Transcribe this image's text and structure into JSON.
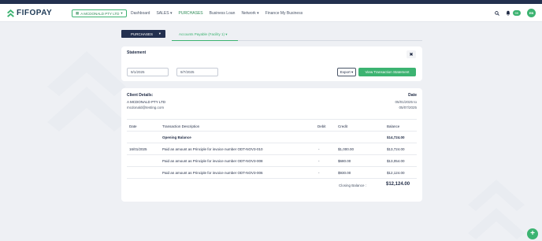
{
  "brand": {
    "name": "FIFOPAY",
    "accent": "#3cb371",
    "dark": "#23304f"
  },
  "navbar": {
    "company_select": "A MCDONALD PTY LTD",
    "items": [
      {
        "label": "Dashboard",
        "active": false
      },
      {
        "label": "SALES ▾",
        "active": false
      },
      {
        "label": "PURCHASES",
        "active": true
      },
      {
        "label": "Business Loan",
        "active": false
      },
      {
        "label": "Network ▾",
        "active": false
      },
      {
        "label": "Finance My Business",
        "active": false
      }
    ],
    "notification_count": "99",
    "avatar_initials": "EB"
  },
  "subnav": {
    "purchases_label": "PURCHASES",
    "ap_tab_label": "Accounts Payable (Facility 1) ▾"
  },
  "statement": {
    "title": "Statement",
    "close_icon": "✖",
    "start_date": "9/1/2025",
    "end_date": "9/7/2025",
    "export_label": "Export ▾",
    "view_label": "View Transaction Statement"
  },
  "report": {
    "client_label": "Client Details:",
    "client_name": "A MCDONALD PTY LTD",
    "client_email": "mcdonald@testing.com",
    "date_label": "Date",
    "date_from": "05/01/2025 to",
    "date_to": "05/07/2025",
    "headers": [
      "Date",
      "Transaction Description",
      "Debit",
      "Credit",
      "Balance"
    ],
    "opening_label": "Opening Balance",
    "opening_balance": "$14,724.00",
    "rows": [
      {
        "date": "16/01/2025",
        "desc": "Paid an amount as Principle for invoice number ODT-NOV3-010",
        "debit": "-",
        "credit": "$1,000.00",
        "balance": "$13,724.00"
      },
      {
        "date": "",
        "desc": "Paid an amount as Principle for invoice number ODT-NOV3-008",
        "debit": "-",
        "credit": "$680.00",
        "balance": "$13,054.00"
      },
      {
        "date": "",
        "desc": "Paid an amount as Principle for invoice number ODT-NOV3-006",
        "debit": "-",
        "credit": "$930.00",
        "balance": "$12,124.00"
      }
    ],
    "closing_label": "Closing Balance :",
    "closing_balance": "$12,124.00"
  },
  "fab_label": "+"
}
